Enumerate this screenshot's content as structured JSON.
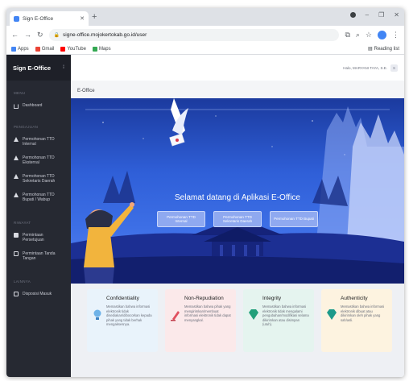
{
  "browser": {
    "tab_title": "Sign E-Office",
    "url": "signe-office.mojokertokab.go.id/user",
    "bookmarks": [
      "Apps",
      "Gmail",
      "YouTube",
      "Maps"
    ],
    "reading_list": "Reading list"
  },
  "sidebar": {
    "brand": "Sign E-Office",
    "sections": [
      {
        "label": "MENU",
        "items": [
          {
            "label": "Dashboard",
            "icon": "home-icon"
          }
        ]
      },
      {
        "label": "PENGAJUAN",
        "items": [
          {
            "label": "Permohonan TTD Internal",
            "icon": "warning-icon"
          },
          {
            "label": "Permohonan TTD Eksternal",
            "icon": "warning-icon"
          },
          {
            "label": "Permohonan TTD Sekretaris Daerah",
            "icon": "warning-icon"
          },
          {
            "label": "Permohonan TTD Bupati / Wabup",
            "icon": "warning-icon"
          }
        ]
      },
      {
        "label": "RIWAYAT",
        "items": [
          {
            "label": "Permintaan Persetujuan",
            "icon": "check-icon"
          },
          {
            "label": "Permintaan Tanda Tangan",
            "icon": "document-icon"
          }
        ]
      },
      {
        "label": "LAINNYA",
        "items": [
          {
            "label": "Disposisi Masuk",
            "icon": "document-icon"
          }
        ]
      }
    ]
  },
  "header": {
    "user_label": "Halo, MARYANI TAYA, S.E.",
    "avatar_initial": "S"
  },
  "breadcrumb": "E-Office",
  "hero": {
    "title": "Selamat datang di Aplikasi E-Office",
    "buttons": [
      "Permohonan TTD Internal",
      "Permohonan TTD Sekretaris Daerah",
      "Permohonan TTD Bupati"
    ]
  },
  "cards": [
    {
      "title": "Confidentiality",
      "text": "Memastikan bahwa informasi elektronik tidak disediakan/dibocorkan kepada pihak yang tidak berhak mengaksesnya.",
      "icon": "lightbulb-icon",
      "color": "#e9f3fb"
    },
    {
      "title": "Non-Repudiation",
      "text": "Memastikan bahwa pihak yang mengirimkan/membuat informasi elektronik tidak dapat menyangkal.",
      "icon": "pen-icon",
      "color": "#fbe9ea"
    },
    {
      "title": "Integrity",
      "text": "Memastikan bahwa informasi elektronik tidak mengalami pengubahan/modifikasi selama dikirimkan atau disimpan (utuh).",
      "icon": "diamond-icon",
      "color": "#e5f4ef"
    },
    {
      "title": "Authenticity",
      "text": "Memastikan bahwa informasi elektronik dibuat atau dikirimkan oleh pihak yang sah/asli.",
      "icon": "diamond-icon",
      "color": "#fdf3e0"
    }
  ]
}
